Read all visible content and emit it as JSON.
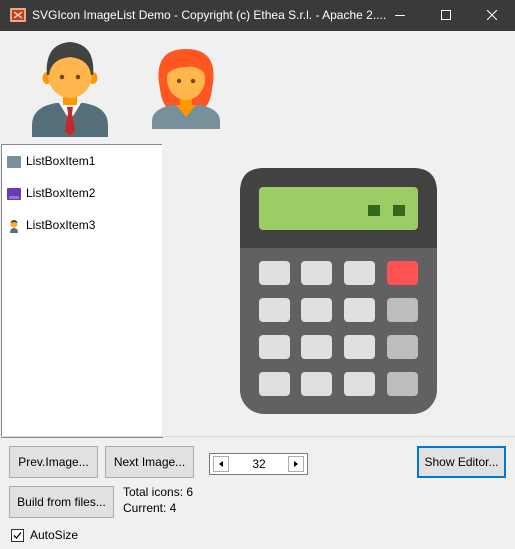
{
  "window": {
    "title": "SVGIcon ImageList Demo - Copyright (c) Ethea S.r.l. - Apache 2....",
    "minimize_icon": "minimize-icon",
    "maximize_icon": "maximize-icon",
    "close_icon": "close-icon"
  },
  "top_icons": [
    "businessman-icon",
    "businesswoman-icon"
  ],
  "listbox": {
    "items": [
      {
        "label": "ListBoxItem1",
        "icon": "gray-square-icon",
        "color": "#78909c"
      },
      {
        "label": "ListBoxItem2",
        "icon": "purple-box-icon",
        "color": "#673ab7"
      },
      {
        "label": "ListBoxItem3",
        "icon": "person-icon",
        "color": "#ffa726"
      }
    ]
  },
  "preview": {
    "icon": "calculator-icon"
  },
  "controls": {
    "prev_label": "Prev.Image...",
    "next_label": "Next Image...",
    "spin_value": "32",
    "show_editor_label": "Show Editor...",
    "build_label": "Build from files...",
    "total_icons": "Total icons: 6",
    "current": "Current: 4",
    "autosize_label": "AutoSize",
    "autosize_checked": true
  },
  "colors": {
    "titlebar": "#3a3a3a",
    "accent": "#0078d7",
    "calculator_display": "#9ccc65",
    "calculator_body": "#616161",
    "calculator_key_red": "#ff5252"
  }
}
